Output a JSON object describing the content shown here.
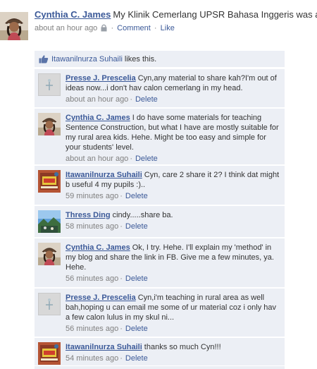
{
  "post": {
    "author": "Cynthia C. James",
    "text": "My Klinik Cemerlang UPSR Bahasa Inggeris was a blast! The kids had fun, and so had I. Worth every hour of my weeken",
    "time": "about an hour ago",
    "privacy_icon": "lock-icon",
    "comment_label": "Comment",
    "like_label": "Like"
  },
  "likes": {
    "icon": "thumbs-up-icon",
    "name": "Itawanilnurza Suhaili",
    "suffix": "likes this."
  },
  "comments": [
    {
      "author": "Presse J. Prescelia",
      "text": "Cyn,any material to share kah?I'm out of ideas now...i don't hav calon cemerlang in my head.",
      "time": "about an hour ago",
      "delete": "Delete",
      "avatar": "default-avatar"
    },
    {
      "author": "Cynthia C. James",
      "text": "I do have some materials for teaching Sentence Construction, but what I have are mostly suitable for my rural area kids. Hehe. Might be too easy and simple for your students' level.",
      "time": "about an hour ago",
      "delete": "Delete",
      "avatar": "cynthia-avatar"
    },
    {
      "author": "Itawanilnurza Suhaili",
      "text": "Cyn, care 2 share it 2? I think dat might b useful 4 my pupils :)..",
      "time": "59 minutes ago",
      "delete": "Delete",
      "avatar": "art-fair-avatar"
    },
    {
      "author": "Thress Ding",
      "text": "cindy.....share ba.",
      "time": "58 minutes ago",
      "delete": "Delete",
      "avatar": "landscape-avatar"
    },
    {
      "author": "Cynthia C. James",
      "text": "Ok, I try. Hehe. I'll explain my 'method' in my blog and share the link in FB. Give me a few minutes, ya. Hehe.",
      "time": "56 minutes ago",
      "delete": "Delete",
      "avatar": "cynthia-avatar"
    },
    {
      "author": "Presse J. Prescelia",
      "text": "Cyn,i'm teaching in rural area as well bah,hoping u can email me some of ur material coz i only hav a few calon lulus in my skul ni...",
      "time": "56 minutes ago",
      "delete": "Delete",
      "avatar": "default-avatar"
    },
    {
      "author": "Itawanilnurza Suhaili",
      "text": "thanks so much Cyn!!!",
      "time": "54 minutes ago",
      "delete": "Delete",
      "avatar": "art-fair-avatar"
    }
  ],
  "colors": {
    "link": "#3b5998",
    "feedback_bg": "#eceff5",
    "meta": "#808080"
  }
}
